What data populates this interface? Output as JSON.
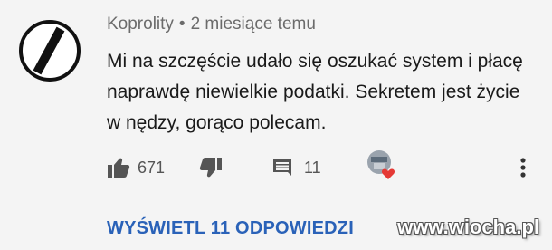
{
  "comment": {
    "author": "Koprolity",
    "separator": "•",
    "time": "2 miesiące temu",
    "text": "Mi na szczęście udało się oszukać system i płacę naprawdę niewielkie podatki. Sekretem jest życie w nędzy, gorąco polecam.",
    "likes": "671",
    "replies": "11",
    "view_replies_label": "WYŚWIETL 11 ODPOWIEDZI"
  },
  "icons": {
    "avatar": "no-entry-sign-icon",
    "like": "thumb-up-icon",
    "dislike": "thumb-down-icon",
    "reply": "comment-icon",
    "hearted": "creator-heart-icon",
    "more": "more-vertical-icon"
  },
  "watermark": "www.wiocha.pl",
  "colors": {
    "link": "#2a62b8",
    "heart": "#e53935",
    "meta": "#6b6b6b"
  }
}
